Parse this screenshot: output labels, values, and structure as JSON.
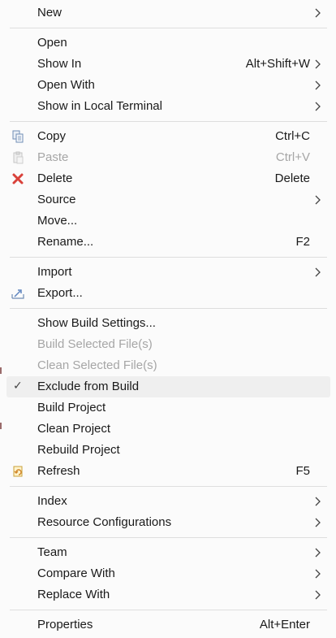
{
  "menu": {
    "new": {
      "label": "New"
    },
    "open": {
      "label": "Open"
    },
    "show_in": {
      "label": "Show In",
      "shortcut": "Alt+Shift+W"
    },
    "open_with": {
      "label": "Open With"
    },
    "show_local_terminal": {
      "label": "Show in Local Terminal"
    },
    "copy": {
      "label": "Copy",
      "shortcut": "Ctrl+C",
      "icon": "copy-icon"
    },
    "paste": {
      "label": "Paste",
      "shortcut": "Ctrl+V",
      "icon": "paste-icon",
      "disabled": true
    },
    "delete": {
      "label": "Delete",
      "shortcut": "Delete",
      "icon": "delete-icon",
      "icon_color": "#d9413a"
    },
    "source": {
      "label": "Source"
    },
    "move": {
      "label": "Move..."
    },
    "rename": {
      "label": "Rename...",
      "shortcut": "F2"
    },
    "import": {
      "label": "Import"
    },
    "export": {
      "label": "Export...",
      "icon": "export-icon"
    },
    "show_build_settings": {
      "label": "Show Build Settings..."
    },
    "build_selected": {
      "label": "Build Selected File(s)",
      "disabled": true
    },
    "clean_selected": {
      "label": "Clean Selected File(s)",
      "disabled": true
    },
    "exclude_from_build": {
      "label": "Exclude from Build",
      "checked": true,
      "check_glyph": "✓"
    },
    "build_project": {
      "label": "Build Project"
    },
    "clean_project": {
      "label": "Clean Project"
    },
    "rebuild_project": {
      "label": "Rebuild Project"
    },
    "refresh": {
      "label": "Refresh",
      "shortcut": "F5",
      "icon": "refresh-icon"
    },
    "index": {
      "label": "Index"
    },
    "resource_configurations": {
      "label": "Resource Configurations"
    },
    "team": {
      "label": "Team"
    },
    "compare_with": {
      "label": "Compare With"
    },
    "replace_with": {
      "label": "Replace With"
    },
    "properties": {
      "label": "Properties",
      "shortcut": "Alt+Enter"
    }
  },
  "colors": {
    "menu_background": "#fbfbfb",
    "hover_background": "#efefef",
    "disabled_text": "#a6a6a6",
    "separator": "#dedede"
  }
}
